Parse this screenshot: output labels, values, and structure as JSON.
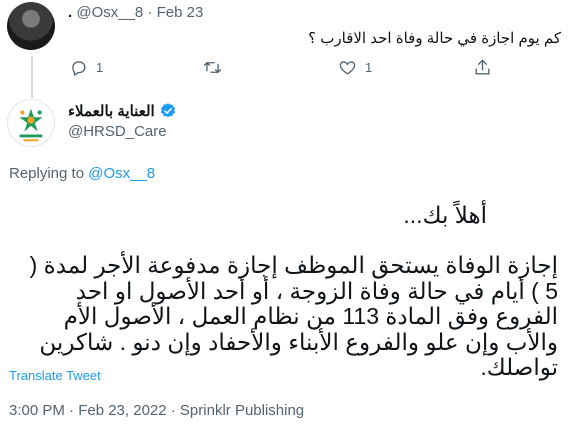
{
  "parent_tweet": {
    "display_name": ".",
    "handle": "@Osx__8",
    "date": "Feb 23",
    "text": "كم يوم اجازة في حالة وفاة احد الاقارب ؟",
    "reply_count": "1",
    "like_count": "1"
  },
  "reply_tweet": {
    "display_name": "العناية بالعملاء",
    "handle": "@HRSD_Care",
    "replying_label": "Replying to",
    "replying_handle": "@Osx__8",
    "greeting": "أهلاً بك...",
    "body": "إجازة الوفاة يستحق الموظف إجازة مدفوعة الأجر لمدة ( 5 ) أيام في حالة وفاة الزوجة ، أو أحد الأصول او احد الفروع وفق المادة 113 من نظام العمل ، الأصول الأم والأب وإن علو والفروع الأبناء والأحفاد وإن دنو . شاكرين تواصلك.",
    "translate_label": "Translate Tweet",
    "timestamp": "3:00 PM · Feb 23, 2022 · Sprinklr Publishing"
  },
  "colors": {
    "accent": "#1d9bf0",
    "muted_text": "#536471",
    "thread_line": "#cfd9de",
    "logo_green": "#1f9a5b",
    "logo_orange": "#f3a51d"
  },
  "icons": [
    "reply-icon",
    "retweet-icon",
    "like-icon",
    "share-icon",
    "verified-badge-icon"
  ]
}
